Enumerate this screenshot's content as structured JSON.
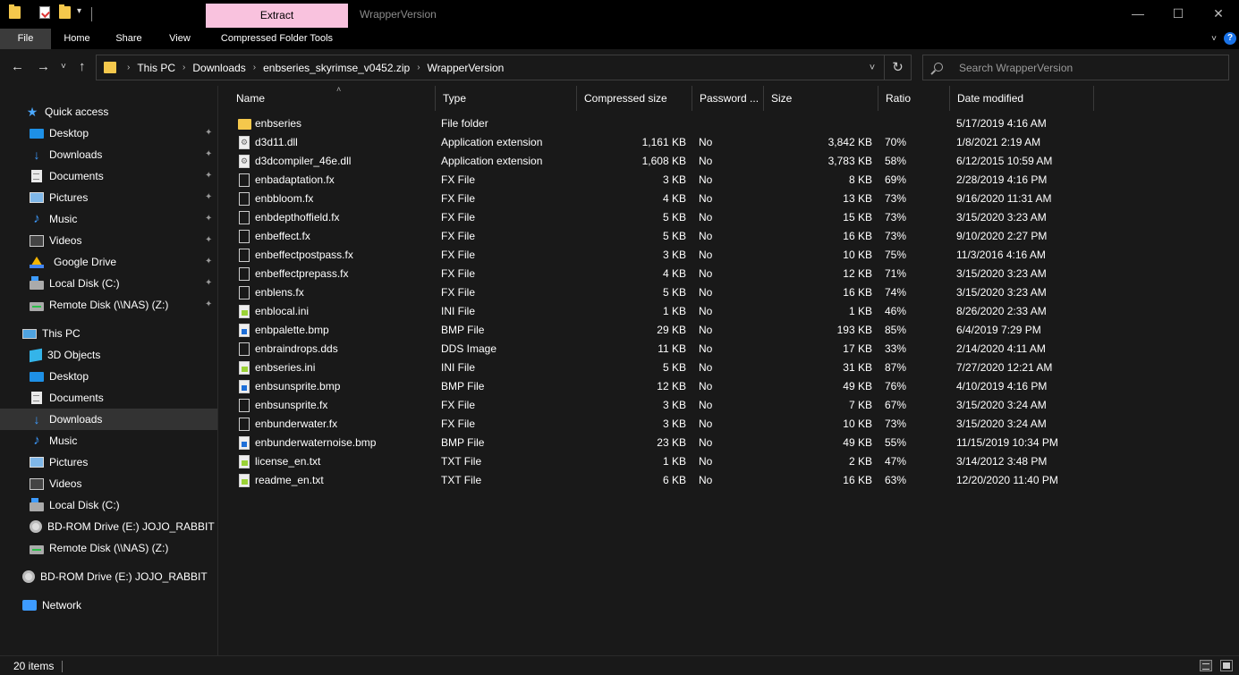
{
  "window": {
    "title": "WrapperVersion",
    "context_tab": "Extract",
    "controls": {
      "minimize": "—",
      "maximize": "☐",
      "close": "✕"
    }
  },
  "ribbon": {
    "tabs": [
      "File",
      "Home",
      "Share",
      "View",
      "Compressed Folder Tools"
    ],
    "collapse_icon": "˅",
    "help_icon": "?"
  },
  "nav": {
    "back": "←",
    "forward": "→",
    "recent": "˅",
    "up": "↑"
  },
  "address": {
    "path": [
      "This PC",
      "Downloads",
      "enbseries_skyrimse_v0452.zip",
      "WrapperVersion"
    ],
    "sep": "›",
    "dropdown": "˅",
    "refresh": "↻"
  },
  "search": {
    "placeholder": "Search WrapperVersion"
  },
  "sidebar": {
    "quick_access": {
      "label": "Quick access",
      "items": [
        {
          "label": "Desktop",
          "icon": "desktop-icon",
          "pinned": true
        },
        {
          "label": "Downloads",
          "icon": "download-icon",
          "pinned": true
        },
        {
          "label": "Documents",
          "icon": "documents-icon",
          "pinned": true
        },
        {
          "label": "Pictures",
          "icon": "pictures-icon",
          "pinned": true
        },
        {
          "label": "Music",
          "icon": "music-icon",
          "pinned": true
        },
        {
          "label": "Videos",
          "icon": "videos-icon",
          "pinned": true
        },
        {
          "label": "Google Drive",
          "icon": "google-drive-icon",
          "pinned": true
        },
        {
          "label": "Local Disk (C:)",
          "icon": "local-disk-icon",
          "pinned": true
        },
        {
          "label": "Remote Disk (\\\\NAS) (Z:)",
          "icon": "network-disk-icon",
          "pinned": true
        }
      ]
    },
    "this_pc": {
      "label": "This PC",
      "items": [
        {
          "label": "3D Objects",
          "icon": "3d-objects-icon"
        },
        {
          "label": "Desktop",
          "icon": "desktop-icon"
        },
        {
          "label": "Documents",
          "icon": "documents-icon"
        },
        {
          "label": "Downloads",
          "icon": "download-icon",
          "selected": true
        },
        {
          "label": "Music",
          "icon": "music-icon"
        },
        {
          "label": "Pictures",
          "icon": "pictures-icon"
        },
        {
          "label": "Videos",
          "icon": "videos-icon"
        },
        {
          "label": "Local Disk (C:)",
          "icon": "local-disk-icon"
        },
        {
          "label": "BD-ROM Drive (E:) JOJO_RABBIT",
          "icon": "bd-rom-icon"
        },
        {
          "label": "Remote Disk (\\\\NAS) (Z:)",
          "icon": "network-disk-icon"
        }
      ]
    },
    "bd_rom": {
      "label": "BD-ROM Drive (E:) JOJO_RABBIT"
    },
    "network": {
      "label": "Network"
    }
  },
  "columns": [
    "Name",
    "Type",
    "Compressed size",
    "Password ...",
    "Size",
    "Ratio",
    "Date modified"
  ],
  "files": [
    {
      "name": "enbseries",
      "type": "File folder",
      "compressed": "",
      "password": "",
      "size": "",
      "ratio": "",
      "date": "5/17/2019 4:16 AM",
      "icon": "folder"
    },
    {
      "name": "d3d11.dll",
      "type": "Application extension",
      "compressed": "1,161 KB",
      "password": "No",
      "size": "3,842 KB",
      "ratio": "70%",
      "date": "1/8/2021 2:19 AM",
      "icon": "dll"
    },
    {
      "name": "d3dcompiler_46e.dll",
      "type": "Application extension",
      "compressed": "1,608 KB",
      "password": "No",
      "size": "3,783 KB",
      "ratio": "58%",
      "date": "6/12/2015 10:59 AM",
      "icon": "dll"
    },
    {
      "name": "enbadaptation.fx",
      "type": "FX File",
      "compressed": "3 KB",
      "password": "No",
      "size": "8 KB",
      "ratio": "69%",
      "date": "2/28/2019 4:16 PM",
      "icon": "file"
    },
    {
      "name": "enbbloom.fx",
      "type": "FX File",
      "compressed": "4 KB",
      "password": "No",
      "size": "13 KB",
      "ratio": "73%",
      "date": "9/16/2020 11:31 AM",
      "icon": "file"
    },
    {
      "name": "enbdepthoffield.fx",
      "type": "FX File",
      "compressed": "5 KB",
      "password": "No",
      "size": "15 KB",
      "ratio": "73%",
      "date": "3/15/2020 3:23 AM",
      "icon": "file"
    },
    {
      "name": "enbeffect.fx",
      "type": "FX File",
      "compressed": "5 KB",
      "password": "No",
      "size": "16 KB",
      "ratio": "73%",
      "date": "9/10/2020 2:27 PM",
      "icon": "file"
    },
    {
      "name": "enbeffectpostpass.fx",
      "type": "FX File",
      "compressed": "3 KB",
      "password": "No",
      "size": "10 KB",
      "ratio": "75%",
      "date": "11/3/2016 4:16 AM",
      "icon": "file"
    },
    {
      "name": "enbeffectprepass.fx",
      "type": "FX File",
      "compressed": "4 KB",
      "password": "No",
      "size": "12 KB",
      "ratio": "71%",
      "date": "3/15/2020 3:23 AM",
      "icon": "file"
    },
    {
      "name": "enblens.fx",
      "type": "FX File",
      "compressed": "5 KB",
      "password": "No",
      "size": "16 KB",
      "ratio": "74%",
      "date": "3/15/2020 3:23 AM",
      "icon": "file"
    },
    {
      "name": "enblocal.ini",
      "type": "INI File",
      "compressed": "1 KB",
      "password": "No",
      "size": "1 KB",
      "ratio": "46%",
      "date": "8/26/2020 2:33 AM",
      "icon": "ini"
    },
    {
      "name": "enbpalette.bmp",
      "type": "BMP File",
      "compressed": "29 KB",
      "password": "No",
      "size": "193 KB",
      "ratio": "85%",
      "date": "6/4/2019 7:29 PM",
      "icon": "bmp"
    },
    {
      "name": "enbraindrops.dds",
      "type": "DDS Image",
      "compressed": "11 KB",
      "password": "No",
      "size": "17 KB",
      "ratio": "33%",
      "date": "2/14/2020 4:11 AM",
      "icon": "dds"
    },
    {
      "name": "enbseries.ini",
      "type": "INI File",
      "compressed": "5 KB",
      "password": "No",
      "size": "31 KB",
      "ratio": "87%",
      "date": "7/27/2020 12:21 AM",
      "icon": "ini"
    },
    {
      "name": "enbsunsprite.bmp",
      "type": "BMP File",
      "compressed": "12 KB",
      "password": "No",
      "size": "49 KB",
      "ratio": "76%",
      "date": "4/10/2019 4:16 PM",
      "icon": "bmp"
    },
    {
      "name": "enbsunsprite.fx",
      "type": "FX File",
      "compressed": "3 KB",
      "password": "No",
      "size": "7 KB",
      "ratio": "67%",
      "date": "3/15/2020 3:24 AM",
      "icon": "file"
    },
    {
      "name": "enbunderwater.fx",
      "type": "FX File",
      "compressed": "3 KB",
      "password": "No",
      "size": "10 KB",
      "ratio": "73%",
      "date": "3/15/2020 3:24 AM",
      "icon": "file"
    },
    {
      "name": "enbunderwaternoise.bmp",
      "type": "BMP File",
      "compressed": "23 KB",
      "password": "No",
      "size": "49 KB",
      "ratio": "55%",
      "date": "11/15/2019 10:34 PM",
      "icon": "bmp"
    },
    {
      "name": "license_en.txt",
      "type": "TXT File",
      "compressed": "1 KB",
      "password": "No",
      "size": "2 KB",
      "ratio": "47%",
      "date": "3/14/2012 3:48 PM",
      "icon": "txt"
    },
    {
      "name": "readme_en.txt",
      "type": "TXT File",
      "compressed": "6 KB",
      "password": "No",
      "size": "16 KB",
      "ratio": "63%",
      "date": "12/20/2020 11:40 PM",
      "icon": "txt"
    }
  ],
  "status": {
    "count": "20 items"
  },
  "colors": {
    "accent": "#f9c2de",
    "background": "#191919",
    "selected": "#333333",
    "folder": "#f5c84c"
  }
}
